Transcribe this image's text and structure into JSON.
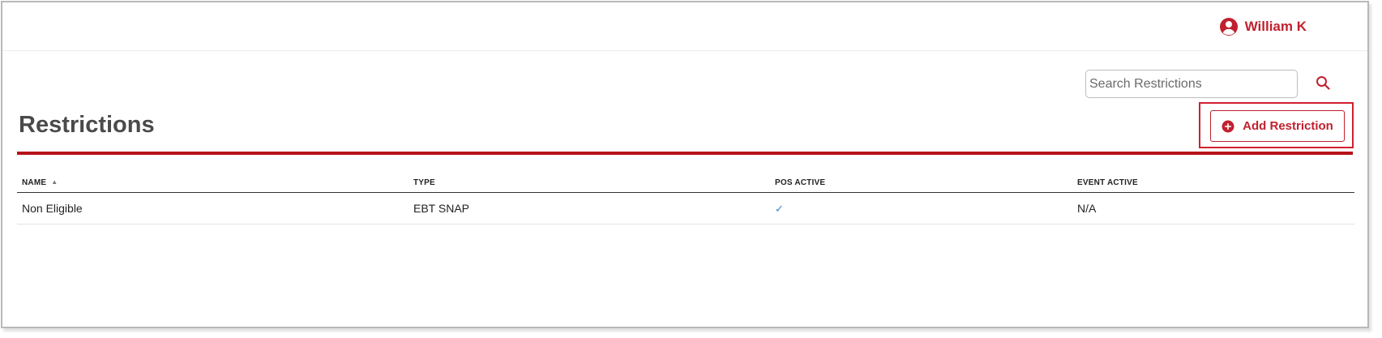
{
  "header": {
    "user_name": "William K",
    "user_icon": "user-circle-icon"
  },
  "search": {
    "placeholder": "Search Restrictions",
    "value": "",
    "icon": "search-icon"
  },
  "page": {
    "title": "Restrictions",
    "add_button_label": "Add Restriction",
    "add_button_icon": "plus-circle-icon"
  },
  "table": {
    "columns": [
      "NAME",
      "TYPE",
      "POS ACTIVE",
      "EVENT ACTIVE"
    ],
    "sort_column": "NAME",
    "sort_direction": "ascending",
    "rows": [
      {
        "name": "Non Eligible",
        "type": "EBT SNAP",
        "pos_active": "✓",
        "event_active": "N/A"
      }
    ]
  },
  "colors": {
    "accent": "#c0212f",
    "rule": "#b5121b",
    "check": "#3a7ed6"
  }
}
